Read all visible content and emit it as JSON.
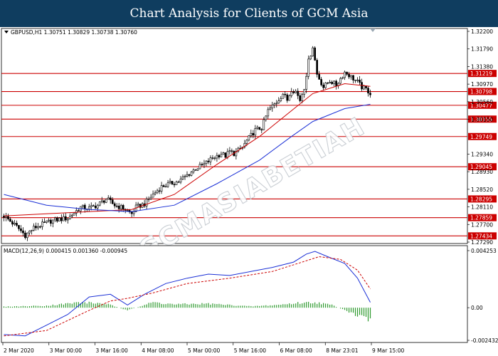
{
  "banner": {
    "title": "Chart Analysis for Clients of GCM Asia"
  },
  "header": {
    "symbol_line": "GBPUSD,H1  1.30751 1.30829 1.30738 1.30760",
    "macd_line": "MACD(12,26,9) 0.000415 0.001360 -0.000945"
  },
  "watermark": {
    "text": "GCMASIABETIAH"
  },
  "colors": {
    "level_line": "#cc0000",
    "candle_up": "#ffffff",
    "candle_down": "#000000",
    "ma_fast": "#cc0000",
    "ma_slow": "#1a2fd6",
    "macd_main": "#1a2fd6",
    "macd_signal": "#cc0000",
    "histogram": "#2e9a2e",
    "banner": "#0f3d5f"
  },
  "chart_data": [
    {
      "type": "candlestick",
      "symbol": "GBPUSD",
      "timeframe": "H1",
      "ylim": [
        1.2729,
        1.322
      ],
      "y_ticks": [
        "1.32200",
        "1.31790",
        "1.31380",
        "1.30970",
        "1.30560",
        "1.30150",
        "1.29340",
        "1.28930",
        "1.28520",
        "1.28110",
        "1.27700",
        "1.27290"
      ],
      "x_ticks": [
        "2 Mar 2020",
        "3 Mar 00:00",
        "3 Mar 16:00",
        "4 Mar 08:00",
        "5 Mar 00:00",
        "5 Mar 16:00",
        "6 Mar 08:00",
        "8 Mar 23:01",
        "9 Mar 15:00"
      ],
      "levels": [
        {
          "value": 1.31219,
          "label": "1.31219"
        },
        {
          "value": 1.30798,
          "label": "1.30798"
        },
        {
          "value": 1.30477,
          "label": "1.30477"
        },
        {
          "value": 1.30155,
          "label": "1.30155"
        },
        {
          "value": 1.29749,
          "label": "1.29749"
        },
        {
          "value": 1.29045,
          "label": "1.29045"
        },
        {
          "value": 1.28295,
          "label": "1.28295"
        },
        {
          "value": 1.27859,
          "label": "1.27859"
        },
        {
          "value": 1.27434,
          "label": "1.27434"
        }
      ],
      "price_path": [
        [
          0,
          1.279
        ],
        [
          6,
          1.2765
        ],
        [
          10,
          1.2745
        ],
        [
          14,
          1.2762
        ],
        [
          18,
          1.277
        ],
        [
          22,
          1.2778
        ],
        [
          26,
          1.2782
        ],
        [
          30,
          1.2785
        ],
        [
          36,
          1.281
        ],
        [
          40,
          1.2808
        ],
        [
          44,
          1.2815
        ],
        [
          48,
          1.283
        ],
        [
          52,
          1.2815
        ],
        [
          56,
          1.2808
        ],
        [
          60,
          1.2795
        ],
        [
          62,
          1.281
        ],
        [
          66,
          1.2818
        ],
        [
          70,
          1.284
        ],
        [
          74,
          1.2858
        ],
        [
          78,
          1.2865
        ],
        [
          82,
          1.287
        ],
        [
          86,
          1.2885
        ],
        [
          90,
          1.29
        ],
        [
          94,
          1.291
        ],
        [
          98,
          1.2925
        ],
        [
          102,
          1.2935
        ],
        [
          104,
          1.293
        ],
        [
          106,
          1.294
        ],
        [
          108,
          1.2935
        ],
        [
          112,
          1.295
        ],
        [
          114,
          1.2965
        ],
        [
          118,
          1.299
        ],
        [
          121,
          1.2995
        ],
        [
          124,
          1.3035
        ],
        [
          128,
          1.3055
        ],
        [
          131,
          1.3075
        ],
        [
          133,
          1.306
        ],
        [
          135,
          1.3085
        ],
        [
          137,
          1.308
        ],
        [
          139,
          1.306
        ],
        [
          141,
          1.309
        ],
        [
          143,
          1.315
        ],
        [
          145,
          1.3185
        ],
        [
          147,
          1.312
        ],
        [
          150,
          1.309
        ],
        [
          153,
          1.3105
        ],
        [
          156,
          1.3095
        ],
        [
          158,
          1.311
        ],
        [
          160,
          1.3125
        ],
        [
          162,
          1.3118
        ],
        [
          164,
          1.311
        ],
        [
          166,
          1.3102
        ],
        [
          168,
          1.309
        ],
        [
          170,
          1.3085
        ],
        [
          172,
          1.3076
        ]
      ],
      "moving_averages": [
        {
          "name": "",
          "color": "#cc0000",
          "points": [
            [
              0,
              1.279
            ],
            [
              20,
              1.2795
            ],
            [
              40,
              1.28
            ],
            [
              60,
              1.2805
            ],
            [
              80,
              1.284
            ],
            [
              100,
              1.291
            ],
            [
              120,
              1.2975
            ],
            [
              135,
              1.3035
            ],
            [
              145,
              1.3075
            ],
            [
              160,
              1.3098
            ],
            [
              172,
              1.3092
            ]
          ]
        },
        {
          "name": "",
          "color": "#1a2fd6",
          "points": [
            [
              0,
              1.284
            ],
            [
              20,
              1.2815
            ],
            [
              40,
              1.2805
            ],
            [
              60,
              1.28
            ],
            [
              80,
              1.2815
            ],
            [
              100,
              1.2865
            ],
            [
              120,
              1.292
            ],
            [
              135,
              1.2975
            ],
            [
              145,
              1.301
            ],
            [
              160,
              1.304
            ],
            [
              172,
              1.305
            ]
          ]
        }
      ]
    },
    {
      "type": "macd",
      "params": "12,26,9",
      "ylim": [
        -0.002432,
        0.004253
      ],
      "y_ticks": [
        "0.004253",
        "0.00",
        "-0.002432"
      ],
      "main_line": [
        [
          0,
          -0.002
        ],
        [
          10,
          -0.0021
        ],
        [
          20,
          -0.0013
        ],
        [
          30,
          -0.0005
        ],
        [
          40,
          0.0008
        ],
        [
          50,
          0.001
        ],
        [
          58,
          0.0002
        ],
        [
          66,
          0.001
        ],
        [
          76,
          0.0018
        ],
        [
          86,
          0.0022
        ],
        [
          96,
          0.0025
        ],
        [
          106,
          0.0024
        ],
        [
          116,
          0.0027
        ],
        [
          126,
          0.003
        ],
        [
          136,
          0.0034
        ],
        [
          142,
          0.004
        ],
        [
          146,
          0.0042
        ],
        [
          152,
          0.0038
        ],
        [
          160,
          0.0033
        ],
        [
          166,
          0.0022
        ],
        [
          172,
          0.0004
        ]
      ],
      "signal_line": [
        [
          0,
          -0.0021
        ],
        [
          20,
          -0.0017
        ],
        [
          40,
          -0.0002
        ],
        [
          50,
          0.0005
        ],
        [
          58,
          0.0007
        ],
        [
          70,
          0.0011
        ],
        [
          86,
          0.0018
        ],
        [
          106,
          0.0022
        ],
        [
          126,
          0.0027
        ],
        [
          140,
          0.0034
        ],
        [
          148,
          0.0038
        ],
        [
          158,
          0.0036
        ],
        [
          166,
          0.0028
        ],
        [
          172,
          0.0014
        ]
      ],
      "histogram": [
        [
          0,
          8e-05
        ],
        [
          20,
          0.00015
        ],
        [
          36,
          0.0004
        ],
        [
          48,
          0.0003
        ],
        [
          58,
          -0.0002
        ],
        [
          70,
          0.0004
        ],
        [
          80,
          0.00025
        ],
        [
          96,
          0.0003
        ],
        [
          106,
          0.0002
        ],
        [
          116,
          0.0001
        ],
        [
          128,
          0.0002
        ],
        [
          138,
          0.00035
        ],
        [
          146,
          0.0004
        ],
        [
          154,
          0.0002
        ],
        [
          160,
          -0.0002
        ],
        [
          166,
          -0.0006
        ],
        [
          172,
          -0.0009
        ]
      ]
    }
  ]
}
